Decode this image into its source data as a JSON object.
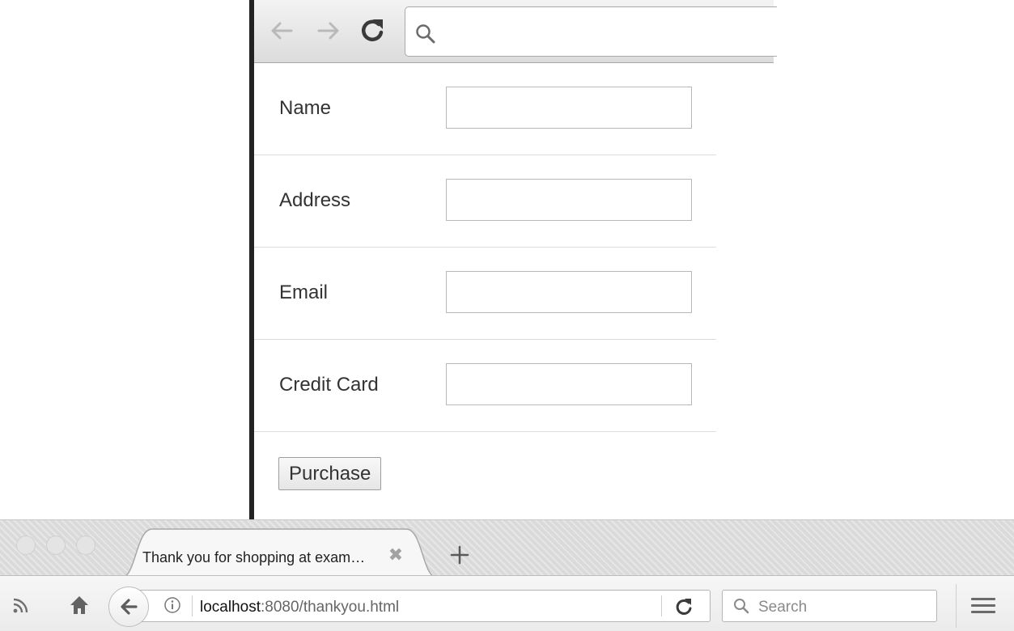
{
  "form": {
    "fields": [
      {
        "label": "Name",
        "value": ""
      },
      {
        "label": "Address",
        "value": ""
      },
      {
        "label": "Email",
        "value": ""
      },
      {
        "label": "Credit Card",
        "value": ""
      }
    ],
    "submit_label": "Purchase"
  },
  "top_browser": {
    "url_value": "",
    "icons": [
      "back-arrow-icon",
      "forward-arrow-icon",
      "reload-icon",
      "search-icon"
    ]
  },
  "browser": {
    "tab_title": "Thank you for shopping at exam…",
    "tab_close_glyph": "✖",
    "url_host": "localhost",
    "url_rest": ":8080/thankyou.html",
    "search_placeholder": "Search",
    "icons": [
      "rss-icon",
      "home-icon",
      "back-arrow-icon",
      "info-icon",
      "reload-icon",
      "search-icon",
      "menu-icon",
      "new-tab-icon"
    ]
  },
  "colors": {
    "chrome_bg": "#dadada",
    "text": "#333333",
    "border": "#b8b8b8"
  }
}
